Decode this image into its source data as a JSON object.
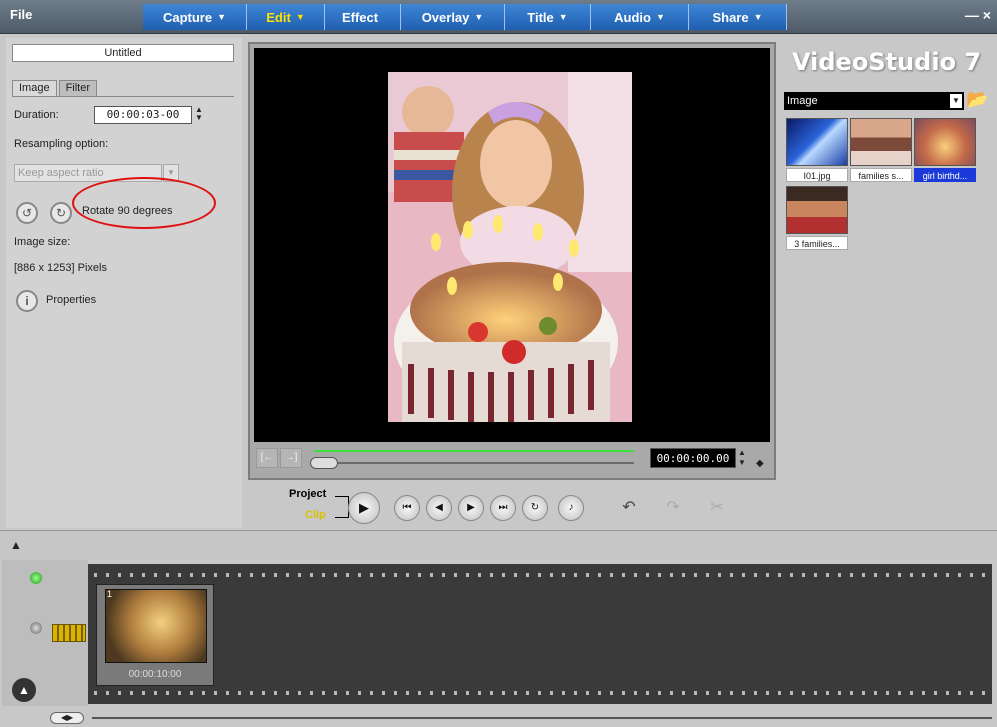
{
  "menu": {
    "file": "File",
    "window_controls": "— ×"
  },
  "steps": [
    {
      "label": "Capture",
      "chev": "▼",
      "active": false,
      "w": 104
    },
    {
      "label": "Edit",
      "chev": "▼",
      "active": true,
      "w": 78
    },
    {
      "label": "Effect",
      "chev": "",
      "active": false,
      "w": 76
    },
    {
      "label": "Overlay",
      "chev": "▼",
      "active": false,
      "w": 104
    },
    {
      "label": "Title",
      "chev": "▼",
      "active": false,
      "w": 86
    },
    {
      "label": "Audio",
      "chev": "▼",
      "active": false,
      "w": 98
    },
    {
      "label": "Share",
      "chev": "▼",
      "active": false,
      "w": 98
    }
  ],
  "left": {
    "project_title": "Untitled",
    "tab_image": "Image",
    "tab_filter": "Filter",
    "duration_label": "Duration:",
    "duration_value": "00:00:03-00",
    "resampling_label": "Resampling option:",
    "resampling_value": "Keep aspect ratio",
    "rotate_label": "Rotate 90 degrees",
    "image_size_label": "Image size:",
    "image_size_value": "[886 x 1253] Pixels",
    "properties_label": "Properties"
  },
  "preview": {
    "timecode": "00:00:00.00"
  },
  "transport": {
    "project": "Project",
    "clip": "Clip"
  },
  "library": {
    "logo": "VideoStudio 7",
    "category": "Image",
    "items": [
      {
        "caption": "I01.jpg",
        "selected": false
      },
      {
        "caption": "families s...",
        "selected": false
      },
      {
        "caption": "girl birthd...",
        "selected": true
      },
      {
        "caption": "3 families...",
        "selected": false
      }
    ]
  },
  "timeline": {
    "clip_number": "1",
    "clip_time": "00:00:10:00"
  },
  "colors": {
    "accent": "#1f5fb0",
    "highlight": "#e01010",
    "active_step": "#ffe000"
  }
}
